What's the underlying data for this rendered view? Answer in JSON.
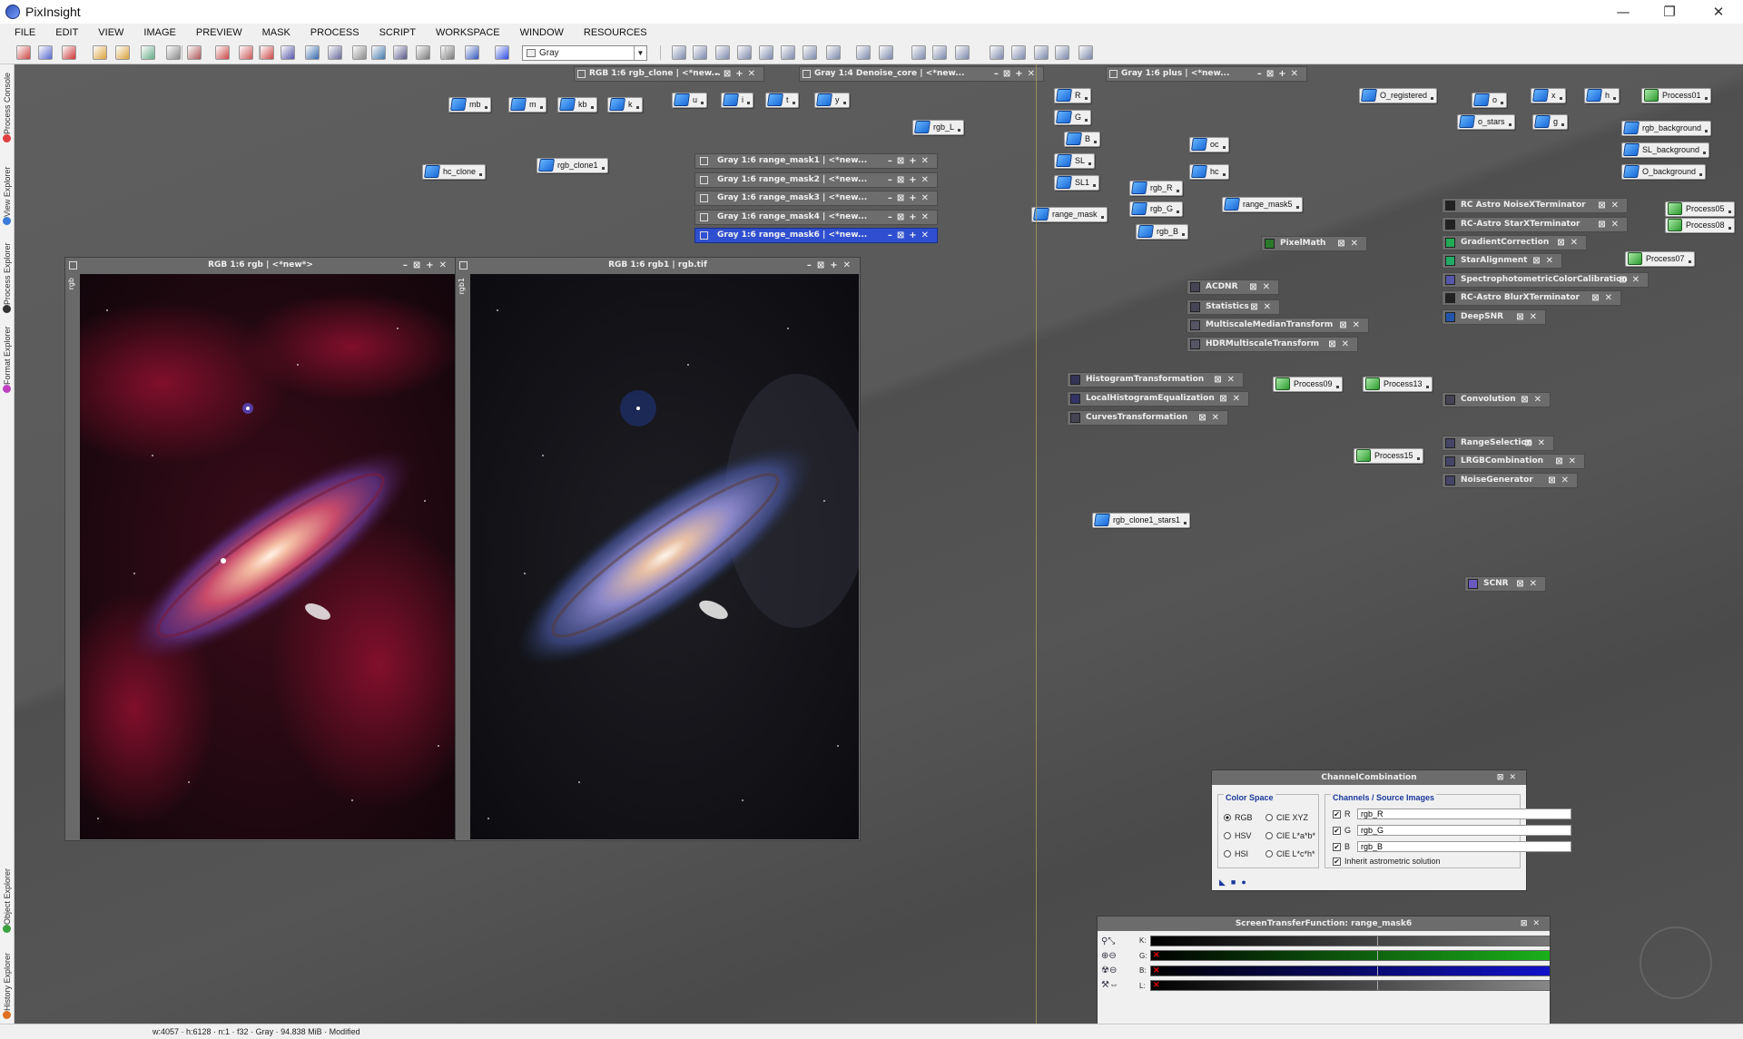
{
  "app": {
    "title": "PixInsight"
  },
  "window_controls": {
    "minimize": "—",
    "restore": "❐",
    "close": "✕"
  },
  "menu": [
    "FILE",
    "EDIT",
    "VIEW",
    "IMAGE",
    "PREVIEW",
    "MASK",
    "PROCESS",
    "SCRIPT",
    "WORKSPACE",
    "WINDOW",
    "RESOURCES"
  ],
  "toolbar": {
    "colorspace_combo": "Gray"
  },
  "side_tabs": [
    "Process Console",
    "View Explorer",
    "Process Explorer",
    "Format Explorer",
    "Object Explorer",
    "History Explorer"
  ],
  "image_windows": [
    {
      "title": "RGB 1:6 rgb | <*new*>",
      "id": "rgb"
    },
    {
      "title": "RGB 1:6 rgb1 | rgb.tif",
      "id": "rgb1"
    }
  ],
  "shaded_windows": {
    "top": [
      {
        "title": "RGB 1:6 rgb_clone | <*new..."
      },
      {
        "title": "Gray 1:4 Denoise_core | <*new..."
      },
      {
        "title": "Gray 1:6 plus | <*new..."
      }
    ],
    "masks": [
      {
        "title": "Gray 1:6 range_mask1 | <*new..."
      },
      {
        "title": "Gray 1:6 range_mask2 | <*new..."
      },
      {
        "title": "Gray 1:6 range_mask3 | <*new..."
      },
      {
        "title": "Gray 1:6 range_mask4 | <*new..."
      },
      {
        "title": "Gray 1:6 range_mask6 | <*new..."
      }
    ]
  },
  "image_icons": [
    "mb",
    "m",
    "kb",
    "k",
    "u",
    "i",
    "t",
    "y",
    "rgb_L",
    "hc_clone",
    "rgb_clone1",
    "R",
    "G",
    "B",
    "SL",
    "SL1",
    "range_mask",
    "rgb_R",
    "rgb_G",
    "rgb_B",
    "oc",
    "hc",
    "range_mask5",
    "O_registered",
    "o",
    "x",
    "h",
    "o_stars",
    "g",
    "rgb_background",
    "SL_background",
    "O_background",
    "rgb_clone1_stars1"
  ],
  "process_icons": [
    "Process01",
    "Process05",
    "Process08",
    "Process07",
    "Process09",
    "Process13",
    "Process15"
  ],
  "process_windows": [
    "PixelMath",
    "ACDNR",
    "Statistics",
    "MultiscaleMedianTransform",
    "HDRMultiscaleTransform",
    "HistogramTransformation",
    "LocalHistogramEqualization",
    "CurvesTransformation",
    "RC Astro NoiseXTerminator",
    "RC-Astro StarXTerminator",
    "GradientCorrection",
    "StarAlignment",
    "SpectrophotometricColorCalibration",
    "RC-Astro BlurXTerminator",
    "DeepSNR",
    "Convolution",
    "RangeSelection",
    "LRGBCombination",
    "NoiseGenerator",
    "SCNR"
  ],
  "channel_combination": {
    "title": "ChannelCombination",
    "color_space_label": "Color Space",
    "color_spaces": [
      "RGB",
      "CIE XYZ",
      "HSV",
      "CIE L*a*b*",
      "HSI",
      "CIE L*c*h*"
    ],
    "selected": "RGB",
    "sources_label": "Channels / Source Images",
    "channels": [
      {
        "ch": "R",
        "image": "rgb_R"
      },
      {
        "ch": "G",
        "image": "rgb_G"
      },
      {
        "ch": "B",
        "image": "rgb_B"
      }
    ],
    "inherit_label": "Inherit astrometric solution"
  },
  "stf": {
    "title": "ScreenTransferFunction: range_mask6",
    "rows": [
      {
        "label": "K:",
        "color": "#888888"
      },
      {
        "label": "G:",
        "color": "#1ec81e"
      },
      {
        "label": "B:",
        "color": "#1414e6"
      },
      {
        "label": "L:",
        "color": "#999999"
      }
    ]
  },
  "status": {
    "text": "w:4057 · h:6128 · n:1 · f32 · Gray · 94.838 MiB · Modified"
  }
}
